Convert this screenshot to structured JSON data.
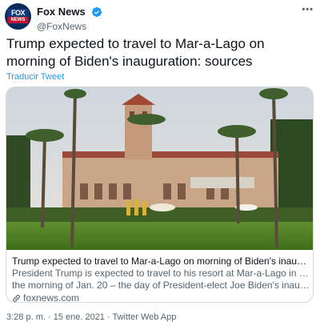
{
  "account": {
    "display_name": "Fox News",
    "handle": "@FoxNews",
    "logo_top": "FOX",
    "logo_bottom": "NEWS",
    "verified_color": "#1d9bf0"
  },
  "menu": {
    "more_label": "•••"
  },
  "tweet": {
    "text": "Trump expected to travel to Mar-a-Lago on morning of Biden's inauguration: sources",
    "translate_label": "Traducir Tweet"
  },
  "card": {
    "title": "Trump expected to travel to Mar-a-Lago on morning of Biden's inauguratio...",
    "description_line1": "President Trump is expected to travel to his resort at Mar-a-Lago in Florida",
    "description_line2": "the morning of Jan. 20 – the day of President-elect Joe Biden's inaugurati...",
    "domain": "foxnews.com",
    "link_icon": "link-icon"
  },
  "footer": {
    "timestamp": "3:28 p. m. · 15 ene. 2021 · Twitter Web App"
  },
  "colors": {
    "accent": "#1d9bf0",
    "text": "#0f1419",
    "secondary": "#536471",
    "border": "#cfd9de"
  }
}
